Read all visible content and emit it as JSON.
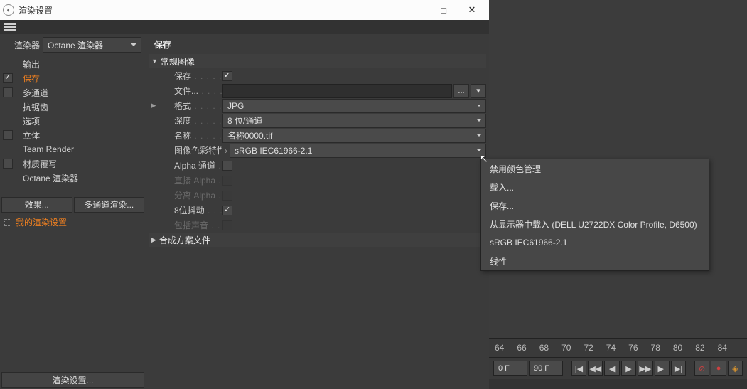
{
  "window": {
    "title": "渲染设置",
    "minimize": "–",
    "maximize": "□",
    "close": "✕"
  },
  "renderer": {
    "label": "渲染器",
    "value": "Octane 渲染器"
  },
  "sidebar": {
    "items": [
      {
        "label": "输出",
        "checkbox": false
      },
      {
        "label": "保存",
        "checkbox": true,
        "checked": true,
        "active": true
      },
      {
        "label": "多通道",
        "checkbox": true,
        "checked": false
      },
      {
        "label": "抗锯齿",
        "checkbox": false
      },
      {
        "label": "选项",
        "checkbox": false
      },
      {
        "label": "立体",
        "checkbox": true,
        "checked": false
      },
      {
        "label": "Team Render",
        "checkbox": false
      },
      {
        "label": "材质覆写",
        "checkbox": true,
        "checked": false
      },
      {
        "label": "Octane 渲染器",
        "checkbox": false
      }
    ],
    "effect_btn": "效果...",
    "multipass_btn": "多通道渲染...",
    "preset": "我的渲染设置",
    "render_settings_btn": "渲染设置..."
  },
  "panel": {
    "title": "保存",
    "section1": "常规图像",
    "rows": {
      "save": {
        "label": "保存"
      },
      "file": {
        "label": "文件...",
        "browse": "...",
        "more": "▾"
      },
      "format": {
        "label": "格式",
        "value": "JPG"
      },
      "depth": {
        "label": "深度",
        "value": "8 位/通道"
      },
      "name": {
        "label": "名称",
        "value": "名称0000.tif"
      },
      "profile": {
        "label": "图像色彩特性",
        "value": "sRGB IEC61966-2.1"
      },
      "alpha": {
        "label": "Alpha 通道"
      },
      "straight": {
        "label": "直接 Alpha"
      },
      "separate": {
        "label": "分离 Alpha"
      },
      "dither": {
        "label": "8位抖动"
      },
      "sound": {
        "label": "包括声音"
      }
    },
    "section2": "合成方案文件"
  },
  "context_menu": {
    "items": [
      "禁用颜色管理",
      "载入...",
      "保存...",
      "从显示器中载入 (DELL U2722DX Color Profile, D6500)",
      "sRGB IEC61966-2.1",
      "线性"
    ]
  },
  "timeline": {
    "ticks": [
      "64",
      "66",
      "68",
      "70",
      "72",
      "74",
      "76",
      "78",
      "80",
      "82",
      "84"
    ],
    "current": "0 F",
    "end": "90 F"
  }
}
